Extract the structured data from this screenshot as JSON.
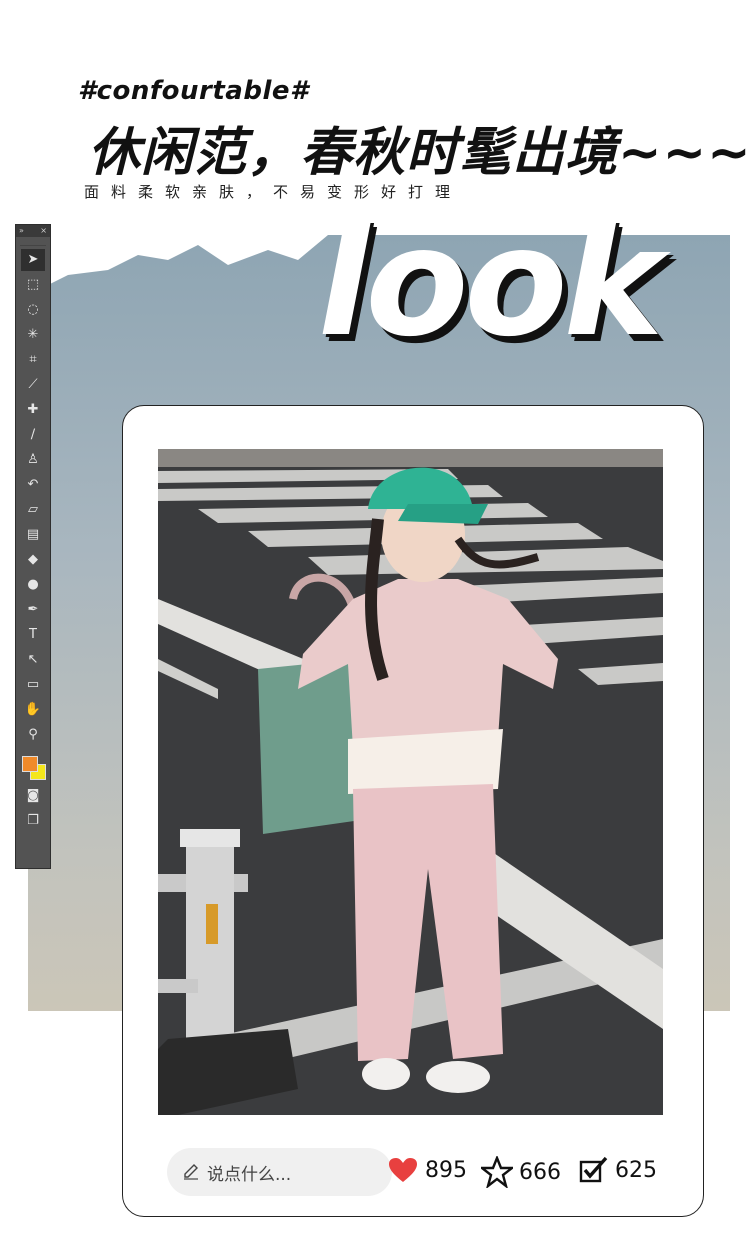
{
  "header": {
    "tag": "#confourtable#",
    "headline": "休闲范，春秋时髦出境~~~",
    "subline": "面料柔软亲肤，不易变形好打理"
  },
  "hero": {
    "look_text": "look"
  },
  "toolbar": {
    "tools": [
      {
        "icon": "move-icon",
        "glyph": "➤"
      },
      {
        "icon": "marquee-icon",
        "glyph": "⬚"
      },
      {
        "icon": "lasso-icon",
        "glyph": "◌"
      },
      {
        "icon": "magic-wand-icon",
        "glyph": "✳"
      },
      {
        "icon": "crop-icon",
        "glyph": "⌗"
      },
      {
        "icon": "eyedropper-icon",
        "glyph": "⟋"
      },
      {
        "icon": "healing-brush-icon",
        "glyph": "✚"
      },
      {
        "icon": "brush-icon",
        "glyph": "∕"
      },
      {
        "icon": "stamp-icon",
        "glyph": "♙"
      },
      {
        "icon": "history-brush-icon",
        "glyph": "↶"
      },
      {
        "icon": "eraser-icon",
        "glyph": "▱"
      },
      {
        "icon": "gradient-icon",
        "glyph": "▤"
      },
      {
        "icon": "blur-icon",
        "glyph": "◆"
      },
      {
        "icon": "dodge-icon",
        "glyph": "●"
      },
      {
        "icon": "pen-icon",
        "glyph": "✒"
      },
      {
        "icon": "type-icon",
        "glyph": "T"
      },
      {
        "icon": "path-select-icon",
        "glyph": "↖"
      },
      {
        "icon": "shape-icon",
        "glyph": "▭"
      },
      {
        "icon": "hand-icon",
        "glyph": "✋"
      },
      {
        "icon": "zoom-icon",
        "glyph": "⚲"
      }
    ],
    "bottom_tools": [
      {
        "icon": "quick-mask-icon",
        "glyph": "◙"
      },
      {
        "icon": "screen-mode-icon",
        "glyph": "❐"
      }
    ],
    "colors": {
      "foreground": "#f08a2a",
      "background": "#f4e61c"
    }
  },
  "post": {
    "comment_placeholder": "说点什么...",
    "likes": "895",
    "favorites": "666",
    "shares": "625",
    "like_color": "#e8403f"
  }
}
